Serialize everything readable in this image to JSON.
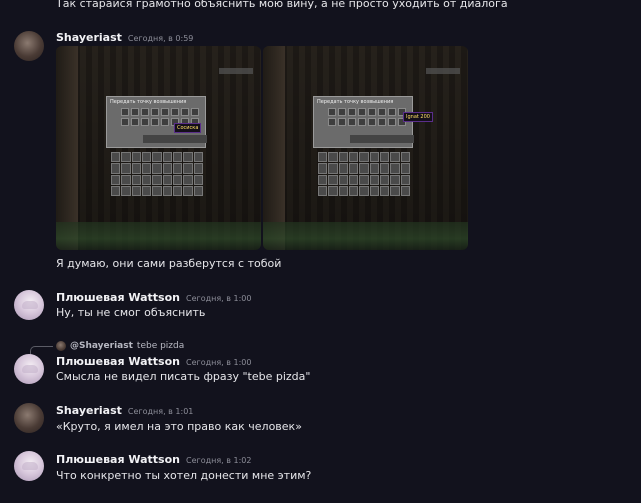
{
  "top_text": "Так старайся грамотно объяснить мою вину, а не просто уходить от диалога",
  "messages": [
    {
      "author": "Shayeriast",
      "timestamp": "Сегодня, в 0:59",
      "avatar": "shayeriast-avatar",
      "attachments": [
        {
          "gui_title": "Передать точку возвышения",
          "tooltip": "Сосиска"
        },
        {
          "gui_title": "Передать точку возвышения",
          "tooltip": "Ignat 200"
        }
      ],
      "text": "Я думаю, они сами разберутся с тобой"
    },
    {
      "author": "Плюшевая Wattson",
      "timestamp": "Сегодня, в 1:00",
      "avatar": "plushevaya-wattson-avatar",
      "text": "Ну, ты не смог объяснить"
    },
    {
      "reply": {
        "mention": "@Shayeriast",
        "text": "tebe pizda"
      },
      "author": "Плюшевая Wattson",
      "timestamp": "Сегодня, в 1:00",
      "avatar": "plushevaya-wattson-avatar",
      "text": "Смысла не видел писать фразу \"tebe pizda\""
    },
    {
      "author": "Shayeriast",
      "timestamp": "Сегодня, в 1:01",
      "avatar": "shayeriast-avatar",
      "text": "«Круто, я имел на это право как человек»"
    },
    {
      "author": "Плюшевая Wattson",
      "timestamp": "Сегодня, в 1:02",
      "avatar": "plushevaya-wattson-avatar",
      "text": "Что конкретно ты хотел донести мне этим?"
    }
  ]
}
